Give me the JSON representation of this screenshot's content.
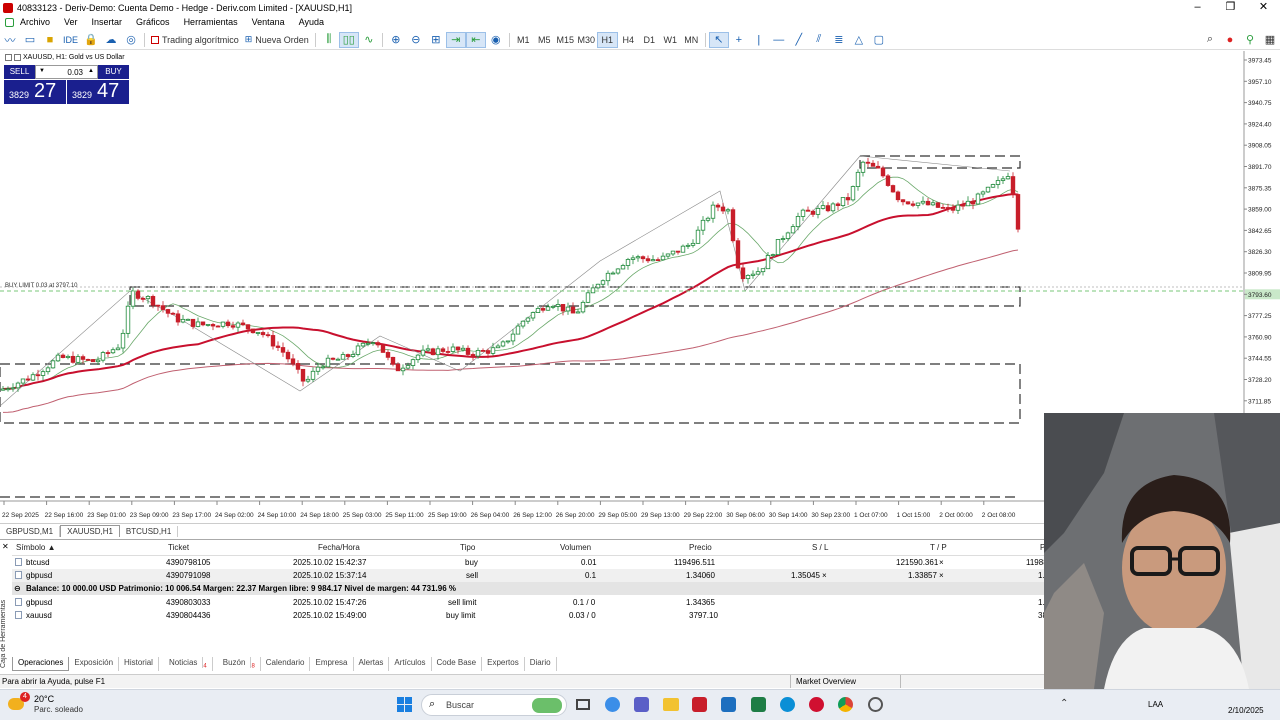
{
  "window": {
    "title": "40833123 - Deriv-Demo: Cuenta Demo - Hedge - Deriv.com Limited - [XAUUSD,H1]"
  },
  "menu": [
    "Archivo",
    "Ver",
    "Insertar",
    "Gráficos",
    "Herramientas",
    "Ventana",
    "Ayuda"
  ],
  "toolbar": {
    "ide_label": "IDE",
    "algo_label": "Trading algorítmico",
    "new_order_label": "Nueva Orden",
    "timeframes": [
      "M1",
      "M5",
      "M15",
      "M30",
      "H1",
      "H4",
      "D1",
      "W1",
      "MN"
    ],
    "active_timeframe": "H1"
  },
  "chart": {
    "title": "XAUUSD, H1:  Gold vs US Dollar",
    "sell_label": "SELL",
    "buy_label": "BUY",
    "volume": "0.03",
    "sell_price_small": "3829",
    "sell_price_big": "27",
    "buy_price_small": "3829",
    "buy_price_big": "47",
    "buy_limit_label": "BUY LIMIT 0.03 at 3797.10",
    "price_axis": [
      "3973.45",
      "3957.10",
      "3940.75",
      "3924.40",
      "3908.05",
      "3891.70",
      "3875.35",
      "3859.00",
      "3842.65",
      "3826.30",
      "3809.95",
      "3793.60",
      "3777.25",
      "3760.90",
      "3744.55",
      "3728.20",
      "3711.85"
    ],
    "current_price": "3793.60",
    "time_axis": [
      "22 Sep 2025",
      "22 Sep 16:00",
      "23 Sep 01:00",
      "23 Sep 09:00",
      "23 Sep 17:00",
      "24 Sep 02:00",
      "24 Sep 10:00",
      "24 Sep 18:00",
      "25 Sep 03:00",
      "25 Sep 11:00",
      "25 Sep 19:00",
      "26 Sep 04:00",
      "26 Sep 12:00",
      "26 Sep 20:00",
      "29 Sep 05:00",
      "29 Sep 13:00",
      "29 Sep 22:00",
      "30 Sep 06:00",
      "30 Sep 14:00",
      "30 Sep 23:00",
      "1 Oct 07:00",
      "1 Oct 15:00",
      "2 Oct 00:00",
      "2 Oct 08:00"
    ],
    "accent_bull": "#1f8a3b",
    "accent_bear": "#c81e2a"
  },
  "chart_tabs": [
    "GBPUSD,M1",
    "XAUUSD,H1",
    "BTCUSD,H1"
  ],
  "active_chart_tab": "XAUUSD,H1",
  "terminal": {
    "side_label": "Caja de Herramientas",
    "columns": [
      "Símbolo",
      "Ticket",
      "Fecha/Hora",
      "Tipo",
      "Volumen",
      "Precio",
      "S / L",
      "T / P",
      "P"
    ],
    "positions": [
      {
        "symbol": "btcusd",
        "ticket": "4390798105",
        "time": "2025.10.02 15:42:37",
        "type": "buy",
        "volume": "0.01",
        "price": "119496.511",
        "sl": "",
        "tp": "121590.361",
        "extra": "11988"
      },
      {
        "symbol": "gbpusd",
        "ticket": "4390791098",
        "time": "2025.10.02 15:37:14",
        "type": "sell",
        "volume": "0.1",
        "price": "1.34060",
        "sl": "1.35045",
        "tp": "1.33857",
        "extra": "1."
      }
    ],
    "balance_line": "Balance: 10 000.00 USD  Patrimonio: 10 006.54  Margen: 22.37  Margen libre: 9 984.17  Nivel de margen: 44 731.96 %",
    "orders": [
      {
        "symbol": "gbpusd",
        "ticket": "4390803033",
        "time": "2025.10.02 15:47:26",
        "type": "sell limit",
        "volume": "0.1 / 0",
        "price": "1.34365",
        "extra": "1."
      },
      {
        "symbol": "xauusd",
        "ticket": "4390804436",
        "time": "2025.10.02 15:49:00",
        "type": "buy limit",
        "volume": "0.03 / 0",
        "price": "3797.10",
        "extra": "38"
      }
    ],
    "tabs": [
      "Operaciones",
      "Exposición",
      "Historial",
      "Noticias",
      "Buzón",
      "Calendario",
      "Empresa",
      "Alertas",
      "Artículos",
      "Code Base",
      "Expertos",
      "Diario"
    ],
    "noticias_badge": "4",
    "buzon_badge": "8"
  },
  "status": {
    "help_text": "Para abrir la Ayuda, pulse F1",
    "profile": "Market Overview"
  },
  "taskbar": {
    "temp": "20°C",
    "weather": "Parc. soleado",
    "weather_badge": "4",
    "search_placeholder": "Buscar",
    "lang": "LAA",
    "date": "2/10/2025"
  }
}
